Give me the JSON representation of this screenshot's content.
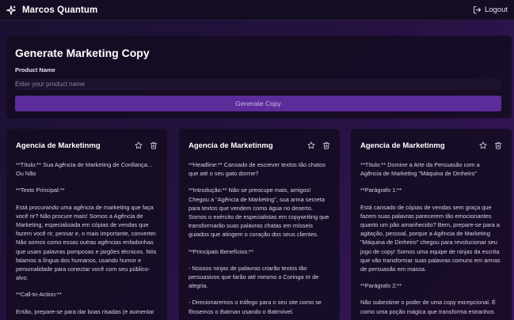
{
  "app": {
    "title": "Marcos Quantum",
    "logout_label": "Logout"
  },
  "generator": {
    "heading": "Generate Marketing Copy",
    "product_label": "Product Name",
    "product_placeholder": "Enter your product name",
    "product_value": "",
    "button_label": "Generate Copy"
  },
  "cards": [
    {
      "title": "Agencia de Marketinmg",
      "paragraphs": [
        "**Título:** Sua Agência de Marketing de Confiança... Ou Não",
        "**Texto Principal:**",
        "Está procurando uma agência de marketing que faça você rir? Não procure mais! Somos a Agência de Marketing, especializada em cópias de vendas que fazem você rir, pensar e, o mais importante, converter. Não somos como essas outras agências enfadonhas que usam palavras pomposas e jargões técnicos. Nós falamos a língua dos humanos, usando humor e personalidade para conectar você com seu público-alvo.",
        "**Call-to-Action:**",
        "Então, prepare-se para dar boas risadas (e aumentar"
      ]
    },
    {
      "title": "Agencia de Marketinmg",
      "paragraphs": [
        "**Headline:** Cansado de escrever textos tão chatos que até o seu gato dorme?",
        "**Introdução:** Não se preocupe mais, amigos! Chegou a \"Agência de Marketing\", sua arma secreta para textos que vendem como água no deserto. Somos o exército de especialistas em copywriting que transformarão suas palavras chatas em mísseis guiados que atingem o coração dos seus clientes.",
        "**Principais Benefícios:**",
        "- Nossos ninjas de palavras criarão textos tão persuasivos que farão até mesmo o Coringa rir de alegria.",
        "- Direcionaremos o tráfego para o seu site como se fôssemos o Batman usando o Batmóvel."
      ]
    },
    {
      "title": "Agencia de Marketinmg",
      "paragraphs": [
        "**Título:** Domine a Arte da Persuasão com a Agência de Marketing \"Máquina de Dinheiro\"",
        "**Parágrafo 1:**",
        "Está cansado de cópias de vendas sem graça que fazem suas palavras parecerem tão emocionantes quanto um pão amanhecido? Bem, prepare-se para a agitação, pessoal, porque a Agência de Marketing \"Máquina de Dinheiro\" chegou para revolucionar seu jogo de copy! Somos uma equipe de ninjas da escrita que vão transformar suas palavras comuns em armas de persuasão em massa.",
        "**Parágrafo 2:**",
        "Não subestime o poder de uma copy excepcional. É como uma poção mágica que transforma estranhos"
      ]
    }
  ]
}
